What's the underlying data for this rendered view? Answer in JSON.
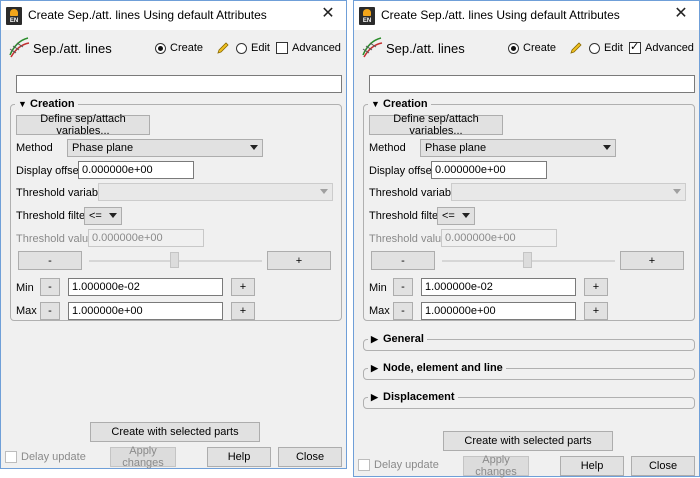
{
  "window_title": "Create Sep./att. lines Using default Attributes",
  "feature_title": "Sep./att. lines",
  "mode": {
    "create": "Create",
    "edit": "Edit",
    "advanced": "Advanced"
  },
  "creation": {
    "header": "Creation",
    "define_button": "Define sep/attach variables...",
    "method_label": "Method",
    "method_value": "Phase plane",
    "display_offset_label": "Display offset",
    "display_offset_value": "0.000000e+00",
    "threshold_variable_label": "Threshold variable",
    "threshold_filter_label": "Threshold filter",
    "threshold_filter_value": "<=",
    "threshold_value_label": "Threshold value",
    "threshold_value_value": "0.000000e+00",
    "minus": "-",
    "plus": "+",
    "min_label": "Min",
    "min_value": "1.000000e-02",
    "max_label": "Max",
    "max_value": "1.000000e+00"
  },
  "advanced_sections": {
    "general": "General",
    "node": "Node, element and line",
    "displacement": "Displacement"
  },
  "footer": {
    "create_button": "Create with selected parts",
    "delay_update": "Delay update",
    "apply_changes": "Apply changes",
    "help": "Help",
    "close": "Close"
  },
  "windows": [
    {
      "advanced_checked": false
    },
    {
      "advanced_checked": true
    }
  ]
}
